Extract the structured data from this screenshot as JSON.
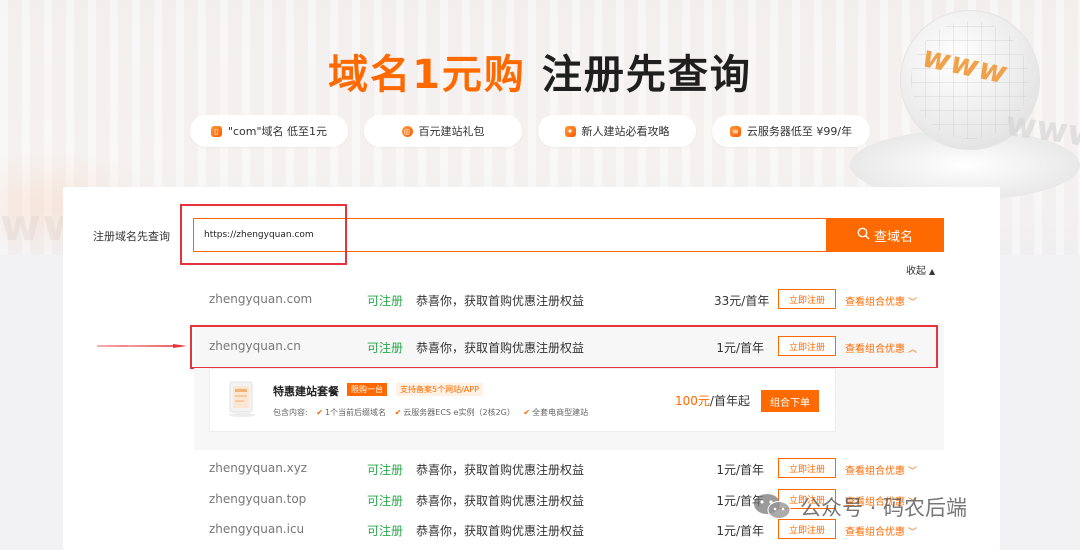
{
  "hero": {
    "title_accent": "域名1元购",
    "title_main": "注册先查询",
    "pills": [
      {
        "label": "\"com\"域名 低至1元",
        "icon": "phone-icon"
      },
      {
        "label": "百元建站礼包",
        "icon": "globe-icon"
      },
      {
        "label": "新人建站必看攻略",
        "icon": "gift-icon"
      },
      {
        "label": "云服务器低至 ¥99/年",
        "icon": "server-icon"
      }
    ],
    "decor_text": "www"
  },
  "search": {
    "label": "注册域名先查询",
    "value": "https://zhengyquan.com",
    "button_label": "查域名"
  },
  "collapse_label": "收起",
  "results": [
    {
      "domain": "zhengyquan.com",
      "status": "可注册",
      "promo": "恭喜你，获取首购优惠注册权益",
      "price": "33元/首年",
      "register": "立即注册",
      "combo": "查看组合优惠"
    },
    {
      "domain": "zhengyquan.cn",
      "status": "可注册",
      "promo": "恭喜你，获取首购优惠注册权益",
      "price": "1元/首年",
      "register": "立即注册",
      "combo": "查看组合优惠"
    },
    {
      "domain": "zhengyquan.xyz",
      "status": "可注册",
      "promo": "恭喜你，获取首购优惠注册权益",
      "price": "1元/首年",
      "register": "立即注册",
      "combo": "查看组合优惠"
    },
    {
      "domain": "zhengyquan.top",
      "status": "可注册",
      "promo": "恭喜你，获取首购优惠注册权益",
      "price": "1元/首年",
      "register": "立即注册",
      "combo": "查看组合优惠"
    },
    {
      "domain": "zhengyquan.icu",
      "status": "可注册",
      "promo": "恭喜你，获取首购优惠注册权益",
      "price": "1元/首年",
      "register": "立即注册",
      "combo": "查看组合优惠"
    }
  ],
  "package": {
    "name": "特惠建站套餐",
    "tag_limited": "限购一台",
    "tag_support": "支持备案5个网站/APP",
    "includes_label": "包含内容:",
    "includes": [
      "1个当前后缀域名",
      "云服务器ECS e实例（2核2G）",
      "全套电商型建站"
    ],
    "price_num": "100元",
    "price_suffix": "/首年起",
    "button_label": "组合下单"
  },
  "watermark": {
    "text": "公众号 · 码农后端"
  },
  "colors": {
    "accent": "#ff6a00",
    "available": "#27a84a",
    "highlight_box": "#e5343a"
  }
}
